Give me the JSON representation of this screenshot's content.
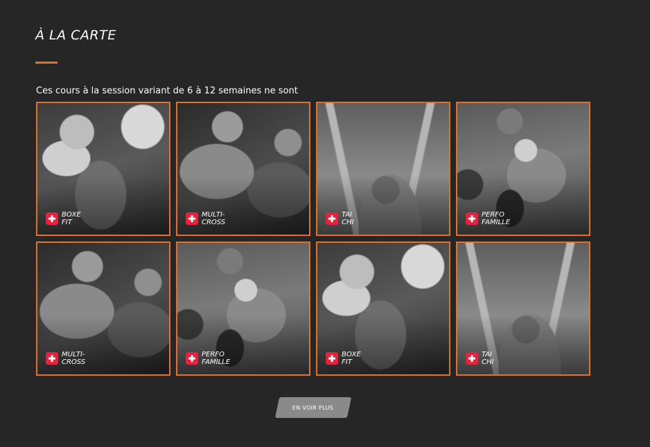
{
  "section": {
    "title": "À LA CARTE",
    "intro": "Ces cours à la session variant de 6 à 12 semaines ne sont"
  },
  "cards": [
    {
      "line1": "BOXE",
      "line2": "FIT",
      "image": "boxing-woman-photo"
    },
    {
      "line1": "MULTI-",
      "line2": "CROSS",
      "image": "trx-training-photo"
    },
    {
      "line1": "TAI",
      "line2": "CHI",
      "image": "tai-chi-photo"
    },
    {
      "line1": "PERFO",
      "line2": "FAMILLE",
      "image": "family-workout-photo"
    },
    {
      "line1": "MULTI-",
      "line2": "CROSS",
      "image": "trx-training-photo"
    },
    {
      "line1": "PERFO",
      "line2": "FAMILLE",
      "image": "family-workout-photo"
    },
    {
      "line1": "BOXE",
      "line2": "FIT",
      "image": "boxing-woman-photo"
    },
    {
      "line1": "TAI",
      "line2": "CHI",
      "image": "tai-chi-photo"
    }
  ],
  "more_button": {
    "label": "EN VOIR PLUS"
  },
  "colors": {
    "background": "#262626",
    "accent": "#e8702a",
    "plus_icon": "#e8213d",
    "button": "#8a8a8a"
  }
}
